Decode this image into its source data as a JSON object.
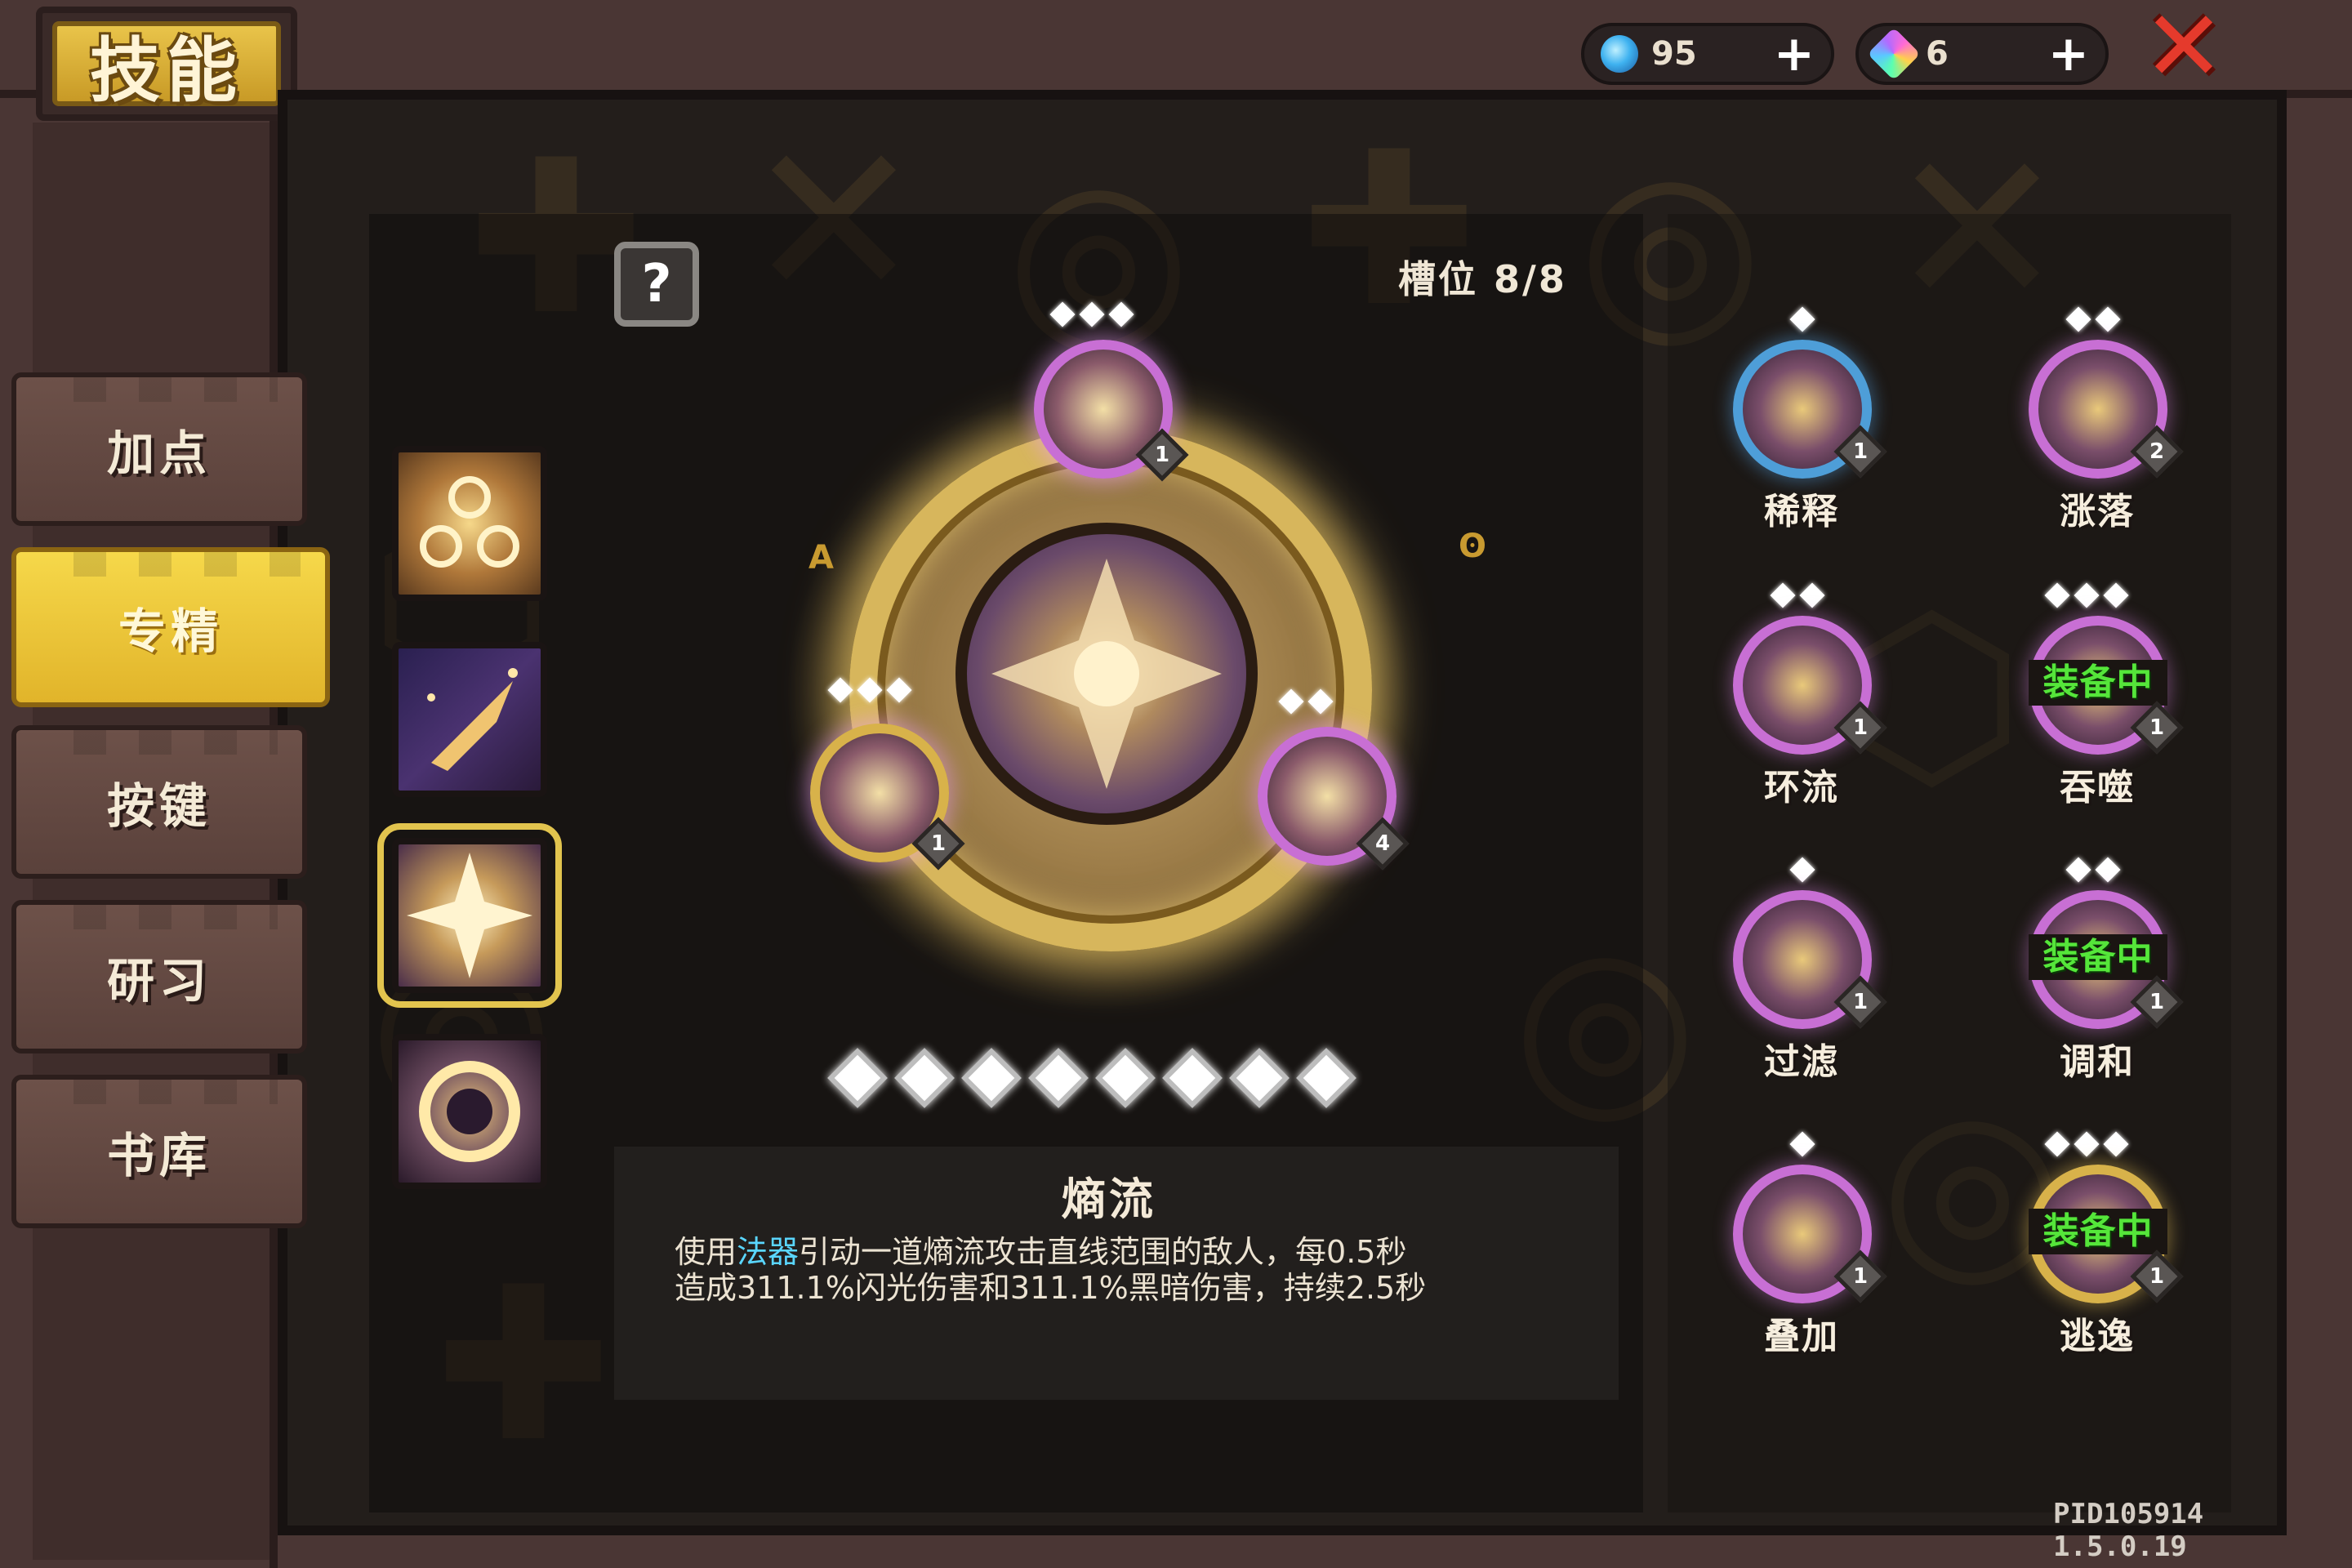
{
  "header": {
    "title": "技能",
    "currencies": [
      {
        "icon": "blue-gem-icon",
        "value": "95",
        "plus": "+"
      },
      {
        "icon": "prism-crystal-icon",
        "value": "6",
        "plus": "+"
      }
    ],
    "close_icon": "close-x-icon"
  },
  "tabs": [
    {
      "label": "加点",
      "active": false
    },
    {
      "label": "专精",
      "active": true
    },
    {
      "label": "按键",
      "active": false
    },
    {
      "label": "研习",
      "active": false
    },
    {
      "label": "书库",
      "active": false
    }
  ],
  "help_label": "?",
  "slot_label": "槽位 8/8",
  "center": {
    "orb_levels": [
      "1",
      "1",
      "4"
    ]
  },
  "description": {
    "title": "熵流",
    "line1_pre": "使用",
    "line1_highlight": "法器",
    "line1_post": "引动一道熵流攻击直线范围的敌人，每0.5秒",
    "line2": "造成311.1%闪光伤害和311.1%黑暗伤害，持续2.5秒"
  },
  "skills": [
    {
      "name": "稀释",
      "level": "1",
      "stars": 1,
      "equipped": false
    },
    {
      "name": "涨落",
      "level": "2",
      "stars": 2,
      "equipped": false
    },
    {
      "name": "环流",
      "level": "1",
      "stars": 2,
      "equipped": false
    },
    {
      "name": "吞噬",
      "level": "1",
      "stars": 3,
      "equipped": true,
      "equipped_label": "装备中"
    },
    {
      "name": "过滤",
      "level": "1",
      "stars": 1,
      "equipped": false
    },
    {
      "name": "调和",
      "level": "1",
      "stars": 2,
      "equipped": true,
      "equipped_label": "装备中"
    },
    {
      "name": "叠加",
      "level": "1",
      "stars": 1,
      "equipped": false
    },
    {
      "name": "逃逸",
      "level": "1",
      "stars": 3,
      "equipped": true,
      "equipped_label": "装备中"
    }
  ],
  "version": "PID105914 1.5.0.19",
  "colors": {
    "accent_gold": "#e1b42a",
    "equipped_green": "#55e63a",
    "highlight_cyan": "#5ad6ff",
    "close_red": "#e53a2c"
  }
}
